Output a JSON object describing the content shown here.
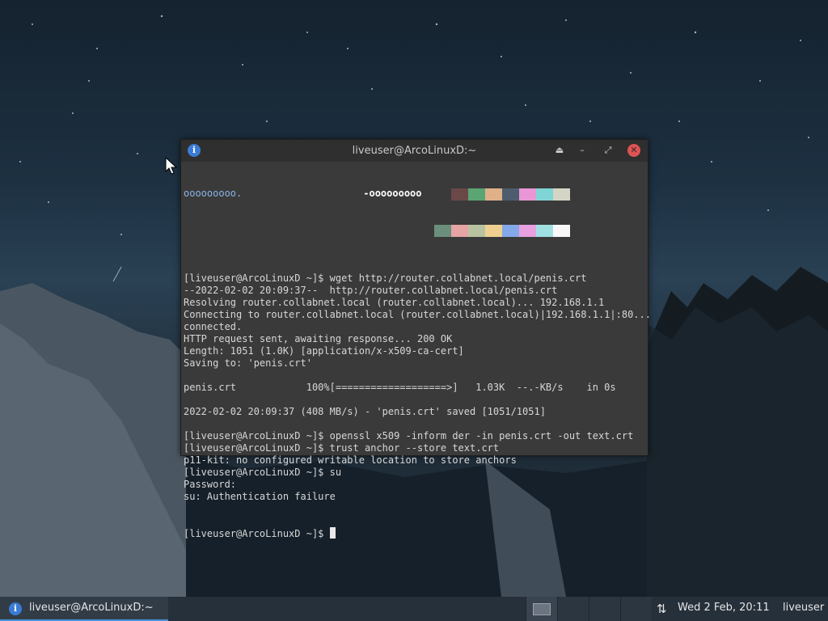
{
  "window": {
    "title": "liveuser@ArcoLinuxD:~",
    "icon": "info-icon",
    "buttons": [
      "keep-above-icon",
      "minimize-icon",
      "maximize-icon",
      "close-icon"
    ]
  },
  "terminal": {
    "top_left_art": "ooooooooo.",
    "top_mid_art": "-ooooooooo",
    "swatch_row1": [
      "#3a3a3a",
      "#6b4848",
      "#5aa572",
      "#e0b088",
      "#4d5d6e",
      "#e896d6",
      "#7fd5d5",
      "#d5d5c5"
    ],
    "swatch_row2": [
      "#6b8f7a",
      "#e6a4a4",
      "#b8c4a0",
      "#f0d090",
      "#84a8e8",
      "#e8a0e0",
      "#a0e0e0",
      "#f8f8f8"
    ],
    "lines": [
      "",
      "",
      "",
      "[liveuser@ArcoLinuxD ~]$ wget http://router.collabnet.local/penis.crt",
      "--2022-02-02 20:09:37--  http://router.collabnet.local/penis.crt",
      "Resolving router.collabnet.local (router.collabnet.local)... 192.168.1.1",
      "Connecting to router.collabnet.local (router.collabnet.local)|192.168.1.1|:80...",
      "connected.",
      "HTTP request sent, awaiting response... 200 OK",
      "Length: 1051 (1.0K) [application/x-x509-ca-cert]",
      "Saving to: 'penis.crt'",
      "",
      "penis.crt            100%[===================>]   1.03K  --.-KB/s    in 0s",
      "",
      "2022-02-02 20:09:37 (408 MB/s) - 'penis.crt' saved [1051/1051]",
      "",
      "[liveuser@ArcoLinuxD ~]$ openssl x509 -inform der -in penis.crt -out text.crt",
      "[liveuser@ArcoLinuxD ~]$ trust anchor --store text.crt",
      "p11-kit: no configured writable location to store anchors",
      "[liveuser@ArcoLinuxD ~]$ su",
      "Password:",
      "su: Authentication failure"
    ],
    "prompt": "[liveuser@ArcoLinuxD ~]$ "
  },
  "taskbar": {
    "task_label": "liveuser@ArcoLinuxD:~",
    "task_icon": "info-icon",
    "network_icon": "network-arrows-icon",
    "clock": "Wed  2 Feb, 20:11",
    "user": "liveuser"
  }
}
